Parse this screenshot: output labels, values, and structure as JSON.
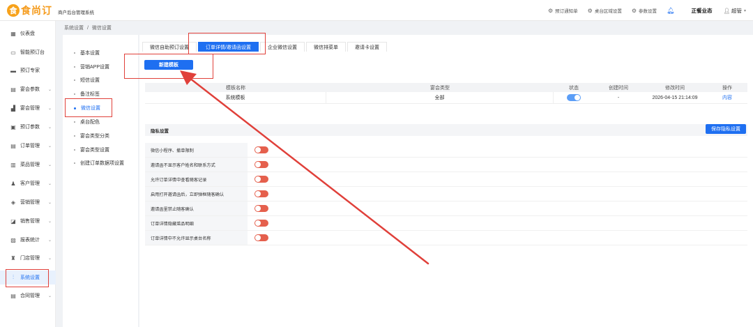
{
  "header": {
    "logo_mark": "食",
    "logo_text": "食尚订",
    "subtitle": "商户后台管理系统",
    "actions": [
      {
        "icon": "gear-icon",
        "label": "预订通知单"
      },
      {
        "icon": "gear-icon",
        "label": "桌台区域设置"
      },
      {
        "icon": "gear-icon",
        "label": "参数设置"
      }
    ],
    "shop_name": "正餐业态",
    "user_name": "超管"
  },
  "sidenav": {
    "items": [
      {
        "label": "仪表盘",
        "icon": "dashboard-icon"
      },
      {
        "label": "智能预订台",
        "icon": "desk-icon"
      },
      {
        "label": "预订专家",
        "icon": "bed-icon"
      },
      {
        "label": "宴会参数",
        "icon": "banquet-icon"
      },
      {
        "label": "宴会管理",
        "icon": "chart-icon"
      },
      {
        "label": "预订参数",
        "icon": "calendar-icon"
      },
      {
        "label": "订单管理",
        "icon": "order-icon"
      },
      {
        "label": "菜品管理",
        "icon": "dish-icon"
      },
      {
        "label": "客户管理",
        "icon": "customer-icon"
      },
      {
        "label": "营销管理",
        "icon": "marketing-icon"
      },
      {
        "label": "销售管理",
        "icon": "sales-icon"
      },
      {
        "label": "报表统计",
        "icon": "report-icon"
      },
      {
        "label": "门店管理",
        "icon": "store-icon"
      },
      {
        "label": "系统设置",
        "icon": "settings-icon"
      },
      {
        "label": "合同管理",
        "icon": "contract-icon"
      }
    ]
  },
  "breadcrumb": {
    "root": "系统设置",
    "sep": "/",
    "current": "微信设置"
  },
  "subnav": {
    "items": [
      "基本设置",
      "营销APP设置",
      "短信设置",
      "备注标签",
      "微信设置",
      "桌台配色",
      "宴会类型分类",
      "宴会类型设置",
      "创建订单数据项设置"
    ]
  },
  "tabs": [
    "微信自助预订设置",
    "订单详情/邀请函设置",
    "企业微信设置",
    "微信排菜单",
    "邀请卡设置"
  ],
  "new_template_button": "新建模板",
  "table": {
    "headers": [
      "模板名称",
      "宴会类型",
      "状态",
      "创建时间",
      "修改时间",
      "操作"
    ],
    "rows": [
      {
        "name": "系统模板",
        "type": "全部",
        "status": true,
        "created": "-",
        "modified": "2026-04-15 21:14:09",
        "action": "内容"
      }
    ]
  },
  "privacy": {
    "title": "隐私设置",
    "save_button": "保存隐私设置",
    "rows": [
      {
        "label": "微信小程序、撤单限制",
        "enabled": false
      },
      {
        "label": "邀请函不显示客户姓名和联系方式",
        "enabled": false
      },
      {
        "label": "允许订单详情中查看随客记录",
        "enabled": false
      },
      {
        "label": "启用打开邀请函后，立即弹框随客确认",
        "enabled": false
      },
      {
        "label": "邀请函里禁止随客确认",
        "enabled": false
      },
      {
        "label": "订单详情隐藏菜品明细",
        "enabled": false
      },
      {
        "label": "订单详情中不允许显示桌台名称",
        "enabled": false
      }
    ]
  },
  "colors": {
    "accent": "#1e6ff1",
    "toggle_off": "#e5604d",
    "annotation": "#e0403a"
  }
}
